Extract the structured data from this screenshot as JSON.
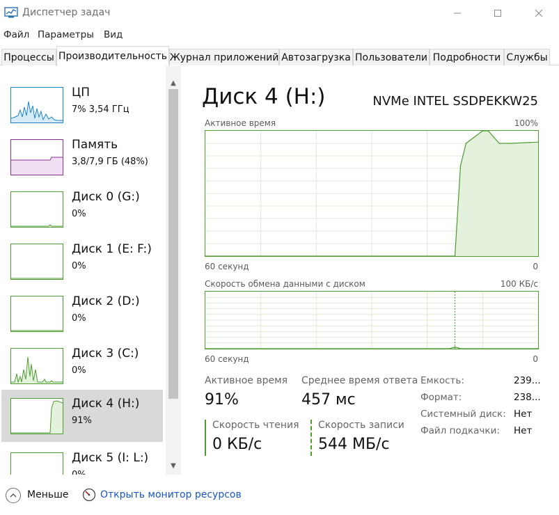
{
  "window": {
    "title": "Диспетчер задач"
  },
  "menu": {
    "items": [
      "Файл",
      "Параметры",
      "Вид"
    ]
  },
  "tabs": [
    {
      "label": "Процессы"
    },
    {
      "label": "Производительность"
    },
    {
      "label": "Журнал приложений"
    },
    {
      "label": "Автозагрузка"
    },
    {
      "label": "Пользователи"
    },
    {
      "label": "Подробности"
    },
    {
      "label": "Службы"
    }
  ],
  "sidebar": {
    "items": [
      {
        "name": "ЦП",
        "sub": "7% 3,54 ГГц",
        "color": "#1a84c8"
      },
      {
        "name": "Память",
        "sub": "3,8/7,9 ГБ (48%)",
        "color": "#8b2f96"
      },
      {
        "name": "Диск 0 (G:)",
        "sub": "0%",
        "color": "#4d9a2f"
      },
      {
        "name": "Диск 1 (E: F:)",
        "sub": "0%",
        "color": "#4d9a2f"
      },
      {
        "name": "Диск 2 (D:)",
        "sub": "0%",
        "color": "#4d9a2f"
      },
      {
        "name": "Диск 3 (C:)",
        "sub": "0%",
        "color": "#4d9a2f"
      },
      {
        "name": "Диск 4 (H:)",
        "sub": "91%",
        "color": "#4d9a2f"
      },
      {
        "name": "Диск 5 (I: L:)",
        "sub": "0%",
        "color": "#4d9a2f"
      }
    ],
    "selected_index": 6
  },
  "main": {
    "title": "Диск 4 (H:)",
    "model": "NVMe INTEL SSDPEKKW25",
    "chart1": {
      "label": "Активное время",
      "max_label": "100%",
      "time_label": "60 секунд",
      "min_label": "0"
    },
    "chart2": {
      "label": "Скорость обмена данными с диском",
      "max_label": "100 КБ/с",
      "time_label": "60 секунд",
      "min_label": "0"
    },
    "stats": {
      "active_time_label": "Активное время",
      "active_time_value": "91%",
      "avg_response_label": "Среднее время ответа",
      "avg_response_value": "457 мс",
      "read_speed_label": "Скорость чтения",
      "read_speed_value": "0 КБ/с",
      "write_speed_label": "Скорость записи",
      "write_speed_value": "544 МБ/с"
    },
    "properties": [
      {
        "label": "Емкость:",
        "value": "239..."
      },
      {
        "label": "Формат:",
        "value": "238..."
      },
      {
        "label": "Системный диск:",
        "value": "Нет"
      },
      {
        "label": "Файл подкачки:",
        "value": "Нет"
      }
    ]
  },
  "footer": {
    "fewer_label": "Меньше",
    "resource_monitor_link": "Открыть монитор ресурсов"
  },
  "colors": {
    "disk_green": "#4d9a2f",
    "disk_fill": "#e4f2dd",
    "cpu_blue": "#1a84c8",
    "memory_purple": "#8b2f96",
    "link_blue": "#1a56c5"
  },
  "chart_data": [
    {
      "type": "area",
      "title": "Активное время",
      "ylabel_max": "100%",
      "xlabel": "60 секунд",
      "x": [
        0,
        45,
        46,
        47,
        50,
        51,
        52,
        53,
        54,
        55,
        60
      ],
      "values": [
        0,
        0,
        72,
        90,
        100,
        100,
        95,
        90,
        90,
        90,
        91
      ],
      "ylim": [
        0,
        100
      ],
      "xlim": [
        0,
        60
      ],
      "grid": true
    },
    {
      "type": "area",
      "title": "Скорость обмена данными с диском",
      "ylabel_max": "100 КБ/с",
      "xlabel": "60 секунд",
      "x": [
        0,
        44,
        45,
        46,
        60
      ],
      "values": [
        0,
        0,
        3,
        0,
        0
      ],
      "ylim": [
        0,
        100
      ],
      "xlim": [
        0,
        60
      ],
      "grid": true
    }
  ]
}
